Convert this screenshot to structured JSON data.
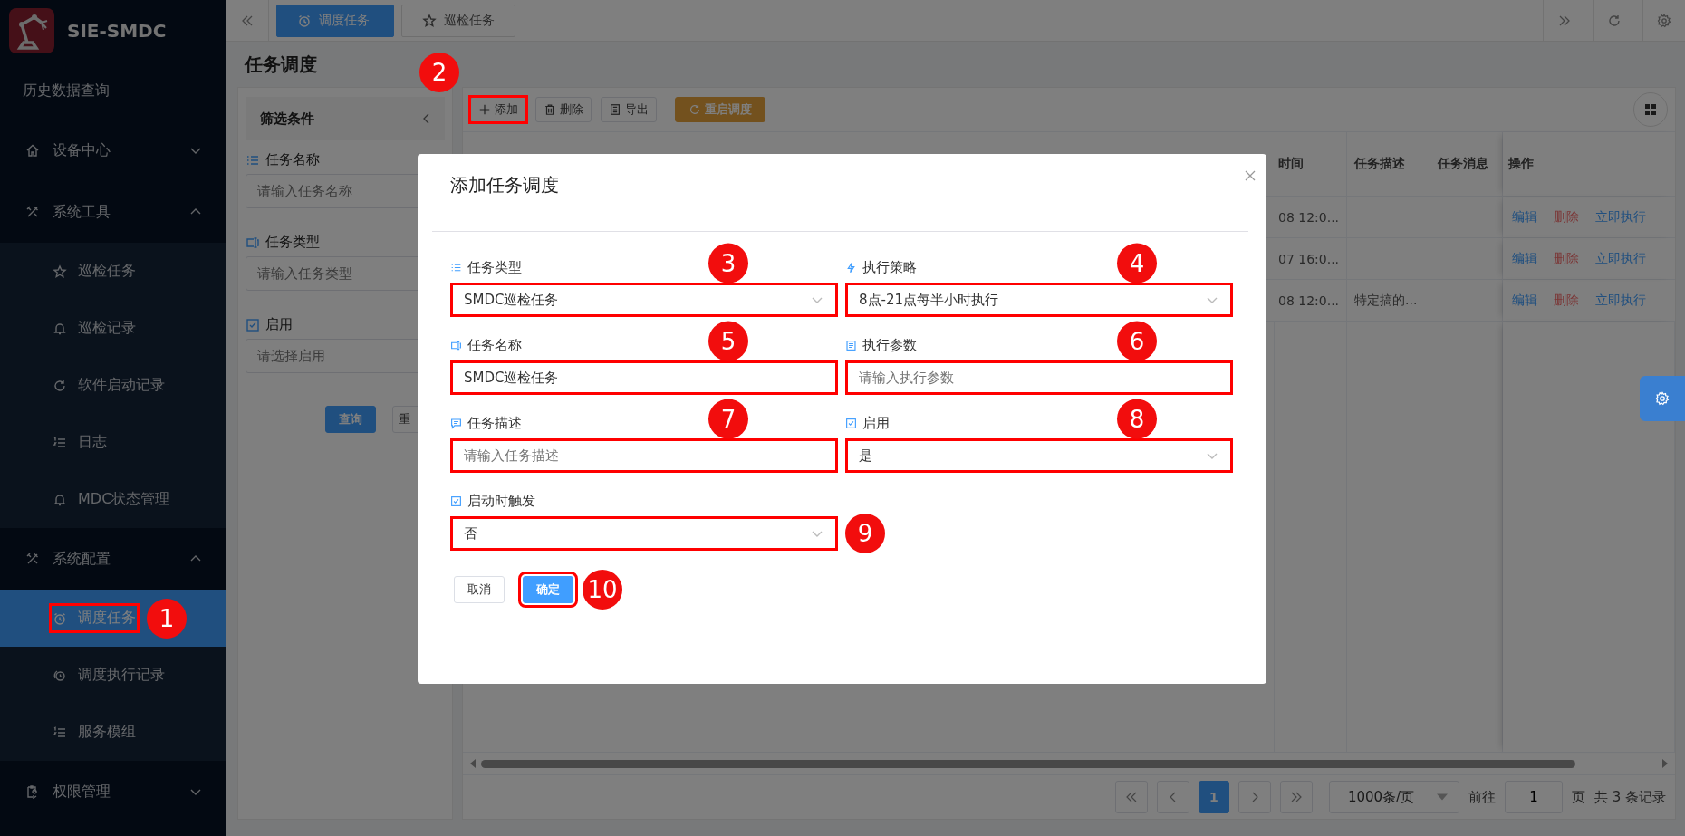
{
  "sidebar": {
    "brand": "SIE-SMDC",
    "items": [
      {
        "label": "历史数据查询",
        "kind": "link"
      },
      {
        "label": "设备中心",
        "kind": "group",
        "expanded": false
      },
      {
        "label": "系统工具",
        "kind": "group",
        "expanded": true,
        "children": [
          {
            "label": "巡检任务",
            "selected": false,
            "highlighted": false
          },
          {
            "label": "巡检记录",
            "selected": false,
            "highlighted": false
          },
          {
            "label": "软件启动记录",
            "selected": false,
            "highlighted": false
          },
          {
            "label": "日志",
            "selected": false,
            "highlighted": false
          },
          {
            "label": "MDC状态管理",
            "selected": false,
            "highlighted": false
          }
        ]
      },
      {
        "label": "系统配置",
        "kind": "group",
        "expanded": true,
        "children": [
          {
            "label": "调度任务",
            "selected": true,
            "highlighted": true,
            "callout": "1"
          },
          {
            "label": "调度执行记录",
            "selected": false,
            "highlighted": false
          },
          {
            "label": "服务模组",
            "selected": false,
            "highlighted": false
          }
        ]
      },
      {
        "label": "权限管理",
        "kind": "group",
        "expanded": false
      }
    ]
  },
  "tabs": [
    {
      "label": "调度任务",
      "selected": true
    },
    {
      "label": "巡检任务",
      "selected": false
    }
  ],
  "page_title": "任务调度",
  "filter": {
    "title": "筛选条件",
    "fields": [
      {
        "label": "任务名称",
        "placeholder": "请输入任务名称"
      },
      {
        "label": "任务类型",
        "placeholder": "请输入任务类型"
      },
      {
        "label": "启用",
        "placeholder": "请选择启用"
      }
    ],
    "buttons": [
      {
        "label": "查询",
        "kind": "primary"
      },
      {
        "label": "重",
        "kind": "default"
      }
    ]
  },
  "toolbar": [
    {
      "label": "添加",
      "kind": "add",
      "highlighted": true,
      "callout": "2"
    },
    {
      "label": "删除",
      "kind": "delete",
      "highlighted": false
    },
    {
      "label": "导出",
      "kind": "export",
      "highlighted": false
    },
    {
      "label": "重启调度",
      "kind": "restart",
      "highlighted": false
    }
  ],
  "table": {
    "columns": [
      "时间",
      "任务描述",
      "任务消息",
      "操作"
    ],
    "rows": [
      {
        "cells": [
          "08 12:0...",
          "",
          " "
        ],
        "actions": [
          {
            "label": "编辑",
            "kind": "edit"
          },
          {
            "label": "删除",
            "kind": "delete"
          },
          {
            "label": "立即执行",
            "kind": "run"
          }
        ]
      },
      {
        "cells": [
          "07 16:0...",
          "",
          " "
        ],
        "actions": [
          {
            "label": "编辑",
            "kind": "edit"
          },
          {
            "label": "删除",
            "kind": "delete"
          },
          {
            "label": "立即执行",
            "kind": "run"
          }
        ]
      },
      {
        "cells": [
          "08 12:0...",
          "特定搞的...",
          " "
        ],
        "actions": [
          {
            "label": "编辑",
            "kind": "edit"
          },
          {
            "label": "删除",
            "kind": "delete"
          },
          {
            "label": "立即执行",
            "kind": "run"
          }
        ]
      }
    ]
  },
  "pagination": {
    "current": "1",
    "page_size": "1000条/页",
    "goto_label": "前往",
    "goto_value": "1",
    "page_unit": "页",
    "total": "共 3 条记录"
  },
  "dialog": {
    "title": "添加任务调度",
    "fields": [
      {
        "label": "任务类型",
        "kind": "select",
        "value": "SMDC巡检任务",
        "highlighted": true,
        "callout": "3"
      },
      {
        "label": "执行策略",
        "kind": "select",
        "value": "8点-21点每半小时执行",
        "highlighted": true,
        "callout": "4"
      },
      {
        "label": "任务名称",
        "kind": "input",
        "value": "SMDC巡检任务",
        "highlighted": true,
        "callout": "5"
      },
      {
        "label": "执行参数",
        "kind": "input",
        "placeholder": "请输入执行参数",
        "highlighted": true,
        "callout": "6"
      },
      {
        "label": "任务描述",
        "kind": "input",
        "placeholder": "请输入任务描述",
        "highlighted": true,
        "callout": "7"
      },
      {
        "label": "启用",
        "kind": "select",
        "value": "是",
        "highlighted": true,
        "callout": "8"
      },
      {
        "label": "启动时触发",
        "kind": "select",
        "value": "否",
        "highlighted": true,
        "callout": "9"
      }
    ],
    "buttons": [
      {
        "label": "取消",
        "kind": "default",
        "highlighted": false
      },
      {
        "label": "确定",
        "kind": "primary",
        "highlighted": true,
        "callout": "10"
      }
    ]
  }
}
